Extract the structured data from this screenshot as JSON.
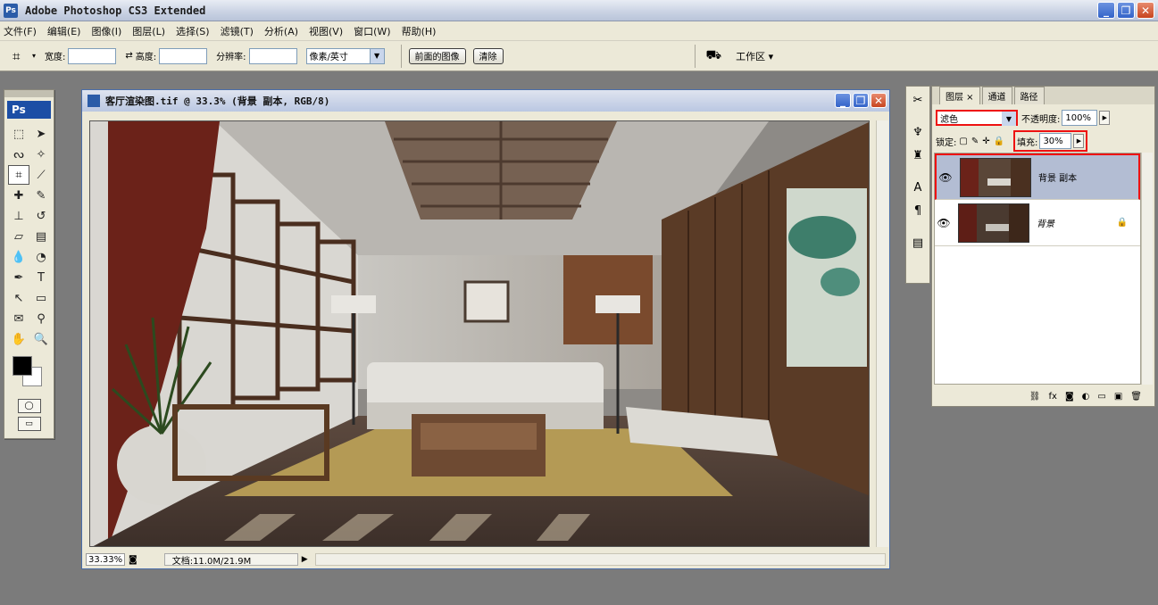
{
  "app": {
    "title": "Adobe Photoshop CS3 Extended"
  },
  "menu": [
    "文件(F)",
    "编辑(E)",
    "图像(I)",
    "图层(L)",
    "选择(S)",
    "滤镜(T)",
    "分析(A)",
    "视图(V)",
    "窗口(W)",
    "帮助(H)"
  ],
  "options": {
    "width_label": "宽度:",
    "height_label": "高度:",
    "resolution_label": "分辨率:",
    "unit_value": "像素/英寸",
    "front_image_button": "前面的图像",
    "clear_button": "清除",
    "workspace_label": "工作区 ▾"
  },
  "document": {
    "title": "客厅渲染图.tif @ 33.3% (背景 副本, RGB/8)",
    "zoom": "33.33%",
    "doc_size": "文档:11.0M/21.9M"
  },
  "layers_panel": {
    "tabs": [
      "图层 ×",
      "通道",
      "路径"
    ],
    "blend_mode": "滤色",
    "opacity_label": "不透明度:",
    "opacity_value": "100%",
    "lock_label": "锁定:",
    "fill_label": "填充:",
    "fill_value": "30%",
    "layers": [
      {
        "name": "背景 副本",
        "selected": true
      },
      {
        "name": "背景",
        "selected": false
      }
    ]
  },
  "colors": {
    "highlight": "#e11111",
    "workspace_bg": "#7b7b7b",
    "selected_layer": "#b3bdd3"
  }
}
